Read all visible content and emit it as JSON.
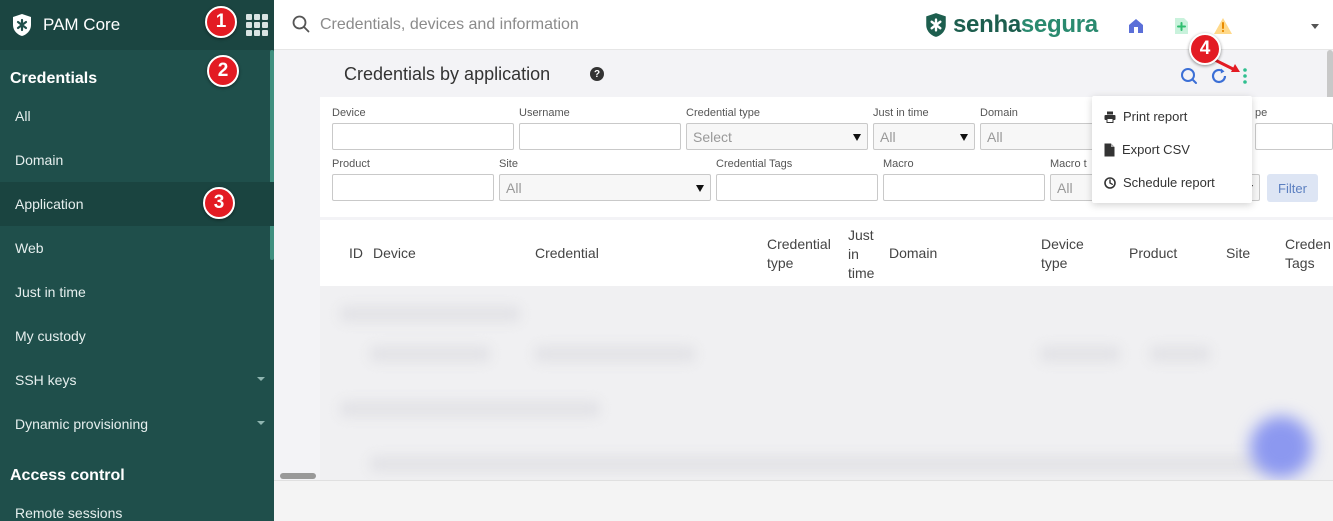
{
  "sidebar": {
    "brand": "PAM Core",
    "sections": [
      {
        "title": "Credentials"
      },
      {
        "title": "Access control"
      }
    ],
    "items": [
      {
        "label": "All"
      },
      {
        "label": "Domain"
      },
      {
        "label": "Application"
      },
      {
        "label": "Web"
      },
      {
        "label": "Just in time"
      },
      {
        "label": "My custody"
      },
      {
        "label": "SSH keys"
      },
      {
        "label": "Dynamic provisioning"
      },
      {
        "label": "Remote sessions"
      }
    ]
  },
  "badges": [
    "1",
    "2",
    "3",
    "4"
  ],
  "topbar": {
    "search_placeholder": "Credentials, devices and information",
    "logo_bold": "senha",
    "logo_light": "segura",
    "icons": [
      "home-icon",
      "add-document-icon",
      "warning-icon"
    ]
  },
  "main": {
    "title": "Credentials by application",
    "filters": {
      "device": "Device",
      "username": "Username",
      "credential_type": "Credential type",
      "credential_type_value": "Select",
      "just_in_time": "Just in time",
      "just_in_time_value": "All",
      "domain": "Domain",
      "domain_value": "All",
      "type_partial": "pe",
      "product": "Product",
      "site": "Site",
      "site_value": "All",
      "credential_tags": "Credential Tags",
      "macro": "Macro",
      "macro_t": "Macro t",
      "macro_t_value": "All",
      "filter_button": "Filter"
    },
    "table_headers": {
      "id": "ID",
      "device": "Device",
      "credential": "Credential",
      "credential_type_1": "Credential",
      "credential_type_2": "type",
      "jit_1": "Just",
      "jit_2": "in",
      "jit_3": "time",
      "domain": "Domain",
      "device_type_1": "Device",
      "device_type_2": "type",
      "product": "Product",
      "site": "Site",
      "cred_tags_1": "Creden",
      "cred_tags_2": "Tags"
    }
  },
  "dropdown": {
    "items": [
      {
        "label": "Print report",
        "icon": "printer-icon"
      },
      {
        "label": "Export CSV",
        "icon": "file-icon"
      },
      {
        "label": "Schedule report",
        "icon": "clock-icon"
      }
    ]
  },
  "colors": {
    "sidebar_bg": "#1f4f4b",
    "badge": "#e31b23",
    "accent_blue": "#3b6fd6",
    "accent_green": "#2fbf8f"
  }
}
